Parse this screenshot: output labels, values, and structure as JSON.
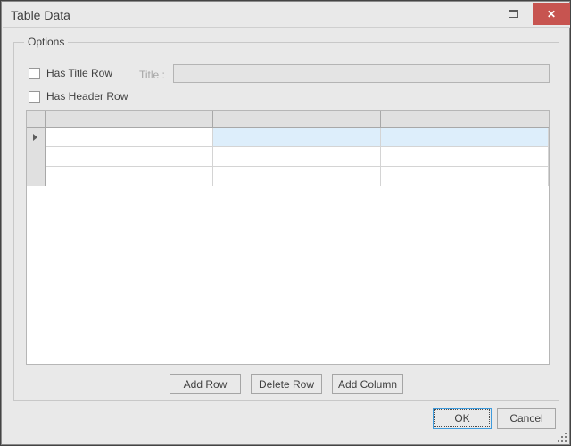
{
  "window": {
    "title": "Table Data",
    "controls": {
      "restore_label": "❐",
      "close_label": "✕"
    }
  },
  "options_group": {
    "legend": "Options",
    "has_title_row": {
      "label": "Has Title Row",
      "checked": false
    },
    "has_header_row": {
      "label": "Has Header Row",
      "checked": false
    },
    "title_field": {
      "label": "Title :",
      "value": "",
      "placeholder": "",
      "enabled": false
    }
  },
  "grid": {
    "row_header_indicator": "current-row-arrow",
    "columns": [
      "",
      "",
      ""
    ],
    "rows": [
      {
        "cells": [
          "",
          "",
          ""
        ],
        "selected": true,
        "current": true
      },
      {
        "cells": [
          "",
          "",
          ""
        ],
        "selected": false,
        "current": false
      },
      {
        "cells": [
          "",
          "",
          ""
        ],
        "selected": false,
        "current": false
      }
    ],
    "selection_color": "#ddeefb"
  },
  "grid_actions": {
    "add_row": "Add Row",
    "delete_row": "Delete Row",
    "add_column": "Add Column"
  },
  "footer": {
    "ok": "OK",
    "cancel": "Cancel"
  }
}
